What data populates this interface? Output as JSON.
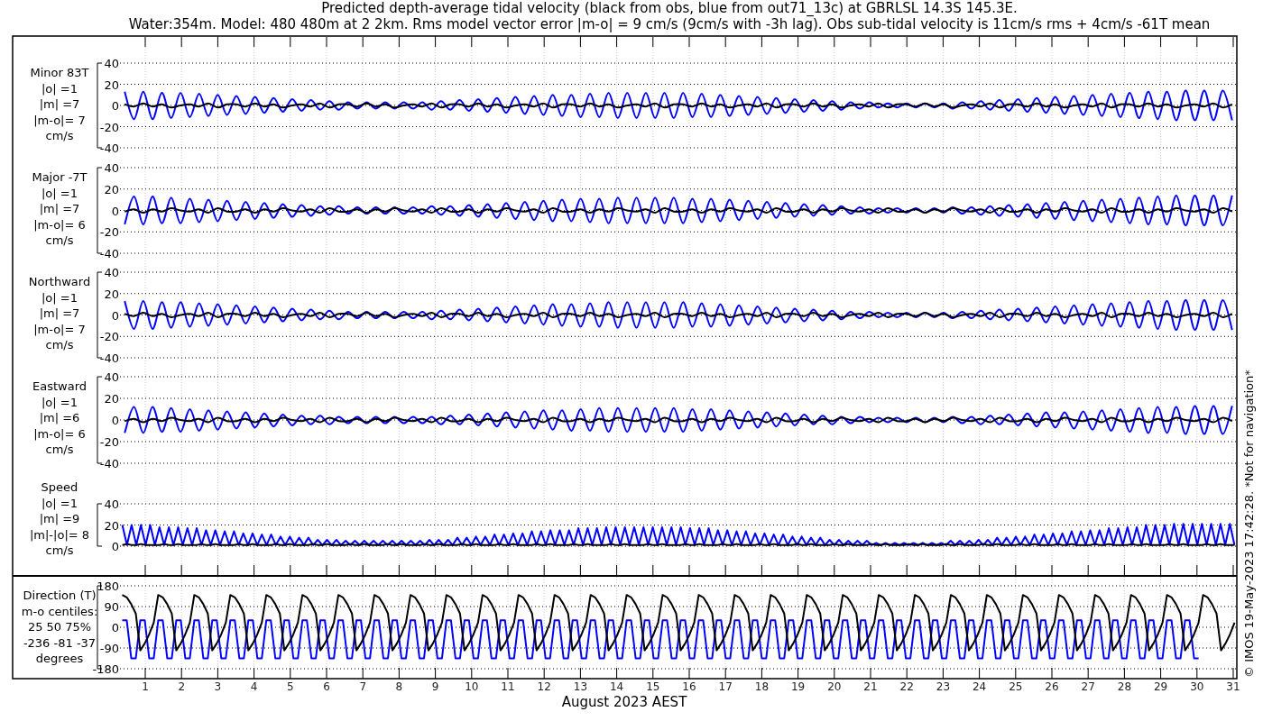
{
  "title": [
    "Predicted depth-average tidal velocity (black from obs, blue from out71_13c) at GBRLSL 14.3S 145.3E.",
    "Water:354m. Model: 480 480m at 2 2km. Rms model vector error |m-o| = 9 cm/s (9cm/s with -3h lag). Obs sub-tidal velocity is 11cm/s rms + 4cm/s -61T mean"
  ],
  "panels": [
    {
      "kind": "velocity",
      "label_lines": [
        "Minor 83T",
        "|o| =1",
        "|m| =7",
        "|m-o|= 7",
        "cm/s"
      ],
      "chart_data": {
        "type": "line",
        "grid": true,
        "ylim": [
          -40,
          40
        ],
        "yticks": [
          40,
          20,
          0,
          -20,
          -40
        ],
        "series": [
          {
            "color": "#000000",
            "values": [
              1,
              -1,
              2,
              -1,
              1,
              -2,
              0,
              1,
              -1,
              2,
              -2,
              1,
              1,
              -1,
              2,
              -1,
              1,
              -2,
              0,
              1,
              -1,
              2,
              -2,
              1,
              1,
              -1,
              2,
              -1,
              1,
              -2,
              0,
              1,
              -1,
              2,
              -2,
              1,
              1,
              -1,
              2,
              -1,
              1,
              -2,
              0,
              1,
              -1,
              2,
              -2,
              1,
              1,
              -1,
              2,
              -1,
              1,
              -2,
              0,
              1,
              -1,
              2,
              -2,
              1,
              1,
              -1,
              2,
              -1,
              1,
              -2,
              0,
              1,
              -1,
              2,
              -2,
              1,
              1,
              -1,
              2,
              -1,
              1,
              -2,
              0,
              1,
              -1,
              2,
              -2,
              1,
              1,
              -1,
              2,
              -1,
              1,
              -2,
              0,
              1,
              -1,
              2,
              -2,
              1,
              1,
              -1,
              2,
              -1,
              1,
              -2,
              0,
              1,
              -1,
              2,
              -2,
              1,
              1,
              -1,
              2,
              -1,
              1,
              -2,
              0,
              1,
              -1,
              2,
              -2,
              1
            ]
          },
          {
            "color": "#0000ff",
            "values": [
              13,
              -13,
              13,
              -13,
              12,
              -12,
              12,
              -11,
              11,
              -10,
              10,
              -9,
              9,
              -8,
              8,
              -7,
              7,
              -6,
              6,
              -5,
              5,
              -4,
              4,
              -4,
              3,
              -3,
              3,
              -3,
              3,
              -3,
              3,
              -3,
              3,
              -4,
              4,
              -4,
              5,
              -5,
              6,
              -6,
              7,
              -7,
              8,
              -8,
              9,
              -9,
              10,
              -10,
              10,
              -11,
              11,
              -11,
              12,
              -12,
              12,
              -12,
              12,
              -12,
              12,
              -12,
              12,
              -11,
              11,
              -11,
              10,
              -10,
              9,
              -9,
              8,
              -8,
              7,
              -7,
              6,
              -6,
              5,
              -5,
              4,
              -4,
              3,
              -3,
              3,
              -2,
              2,
              -2,
              2,
              -2,
              2,
              -2,
              2,
              -3,
              3,
              -3,
              4,
              -4,
              5,
              -5,
              6,
              -6,
              7,
              -7,
              8,
              -8,
              9,
              -9,
              10,
              -10,
              11,
              -11,
              12,
              -12,
              13,
              -13,
              13,
              -14,
              14,
              -14,
              14,
              -14,
              14,
              -14
            ]
          }
        ]
      }
    },
    {
      "kind": "velocity",
      "label_lines": [
        "Major -7T",
        "|o| =1",
        "|m| =7",
        "|m-o|= 6",
        "cm/s"
      ],
      "chart_data": {
        "type": "line",
        "grid": true,
        "ylim": [
          -40,
          40
        ],
        "yticks": [
          40,
          20,
          0,
          -20,
          -40
        ],
        "series": [
          {
            "color": "#000000",
            "values": [
              -1,
              1,
              -2,
              1,
              -1,
              2,
              0,
              -1,
              1,
              -2,
              2,
              -1,
              -1,
              1,
              -2,
              1,
              -1,
              2,
              0,
              -1,
              1,
              -2,
              2,
              -1,
              -1,
              1,
              -2,
              1,
              -1,
              2,
              0,
              -1,
              1,
              -2,
              2,
              -1,
              -1,
              1,
              -2,
              1,
              -1,
              2,
              0,
              -1,
              1,
              -2,
              2,
              -1,
              -1,
              1,
              -2,
              1,
              -1,
              2,
              0,
              -1,
              1,
              -2,
              2,
              -1,
              -1,
              1,
              -2,
              1,
              -1,
              2,
              0,
              -1,
              1,
              -2,
              2,
              -1,
              -1,
              1,
              -2,
              1,
              -1,
              2,
              0,
              -1,
              1,
              -2,
              2,
              -1,
              -1,
              1,
              -2,
              1,
              -1,
              2,
              0,
              -1,
              1,
              -2,
              2,
              -1,
              -1,
              1,
              -2,
              1,
              -1,
              2,
              0,
              -1,
              1,
              -2,
              2,
              -1,
              -1,
              1,
              -2,
              1,
              -1,
              2,
              0,
              -1,
              1,
              -2,
              2,
              -1
            ]
          },
          {
            "color": "#0000ff",
            "values": [
              -13,
              13,
              -13,
              13,
              -12,
              12,
              -12,
              11,
              -11,
              10,
              -10,
              9,
              -9,
              8,
              -8,
              7,
              -7,
              6,
              -6,
              5,
              -5,
              4,
              -4,
              4,
              -3,
              3,
              -3,
              3,
              -3,
              3,
              -3,
              3,
              -3,
              4,
              -4,
              4,
              -5,
              5,
              -6,
              6,
              -7,
              7,
              -8,
              8,
              -9,
              9,
              -10,
              10,
              -10,
              11,
              -11,
              11,
              -12,
              12,
              -12,
              12,
              -12,
              12,
              -12,
              12,
              -12,
              11,
              -11,
              11,
              -10,
              10,
              -9,
              9,
              -8,
              8,
              -7,
              7,
              -6,
              6,
              -5,
              5,
              -4,
              4,
              -3,
              3,
              -3,
              2,
              -2,
              2,
              -2,
              2,
              -2,
              2,
              -2,
              3,
              -3,
              3,
              -4,
              4,
              -5,
              5,
              -6,
              6,
              -7,
              7,
              -8,
              8,
              -9,
              9,
              -10,
              10,
              -11,
              11,
              -12,
              12,
              -13,
              13,
              -13,
              14,
              -14,
              14,
              -14,
              14,
              -14,
              14
            ]
          }
        ]
      }
    },
    {
      "kind": "velocity",
      "label_lines": [
        "Northward",
        "|o| =1",
        "|m| =7",
        "|m-o|= 7",
        "cm/s"
      ],
      "chart_data": {
        "type": "line",
        "grid": true,
        "ylim": [
          -40,
          40
        ],
        "yticks": [
          40,
          20,
          0,
          -20,
          -40
        ],
        "series": [
          {
            "color": "#000000",
            "values": [
              1,
              -1,
              2,
              -1,
              1,
              -2,
              0,
              1,
              -1,
              2,
              -2,
              1,
              1,
              -1,
              2,
              -1,
              1,
              -2,
              0,
              1,
              -1,
              2,
              -2,
              1,
              1,
              -1,
              2,
              -1,
              1,
              -2,
              0,
              1,
              -1,
              2,
              -2,
              1,
              1,
              -1,
              2,
              -1,
              1,
              -2,
              0,
              1,
              -1,
              2,
              -2,
              1,
              1,
              -1,
              2,
              -1,
              1,
              -2,
              0,
              1,
              -1,
              2,
              -2,
              1,
              1,
              -1,
              2,
              -1,
              1,
              -2,
              0,
              1,
              -1,
              2,
              -2,
              1,
              1,
              -1,
              2,
              -1,
              1,
              -2,
              0,
              1,
              -1,
              2,
              -2,
              1,
              1,
              -1,
              2,
              -1,
              1,
              -2,
              0,
              1,
              -1,
              2,
              -2,
              1,
              1,
              -1,
              2,
              -1,
              1,
              -2,
              0,
              1,
              -1,
              2,
              -2,
              1,
              1,
              -1,
              2,
              -1,
              1,
              -2,
              0,
              1,
              -1,
              2,
              -2,
              1
            ]
          },
          {
            "color": "#0000ff",
            "values": [
              13,
              -13,
              13,
              -13,
              12,
              -12,
              12,
              -11,
              11,
              -10,
              10,
              -9,
              9,
              -8,
              8,
              -7,
              7,
              -6,
              6,
              -5,
              5,
              -4,
              4,
              -4,
              3,
              -3,
              3,
              -3,
              3,
              -3,
              3,
              -3,
              3,
              -4,
              4,
              -4,
              5,
              -5,
              6,
              -6,
              7,
              -7,
              8,
              -8,
              9,
              -9,
              10,
              -10,
              10,
              -11,
              11,
              -11,
              12,
              -12,
              12,
              -12,
              12,
              -12,
              12,
              -12,
              12,
              -11,
              11,
              -11,
              10,
              -10,
              9,
              -9,
              8,
              -8,
              7,
              -7,
              6,
              -6,
              5,
              -5,
              4,
              -4,
              3,
              -3,
              3,
              -2,
              2,
              -2,
              2,
              -2,
              2,
              -2,
              2,
              -3,
              3,
              -3,
              4,
              -4,
              5,
              -5,
              6,
              -6,
              7,
              -7,
              8,
              -8,
              9,
              -9,
              10,
              -10,
              11,
              -11,
              12,
              -12,
              13,
              -13,
              13,
              -14,
              14,
              -14,
              14,
              -14,
              14,
              -14
            ]
          }
        ]
      }
    },
    {
      "kind": "velocity",
      "label_lines": [
        "Eastward",
        "|o| =1",
        "|m| =6",
        "|m-o|= 6",
        "cm/s"
      ],
      "chart_data": {
        "type": "line",
        "grid": true,
        "ylim": [
          -40,
          40
        ],
        "yticks": [
          40,
          20,
          0,
          -20,
          -40
        ],
        "series": [
          {
            "color": "#000000",
            "values": [
              -1,
              1,
              -2,
              1,
              -1,
              2,
              0,
              -1,
              1,
              -2,
              2,
              -1,
              -1,
              1,
              -2,
              1,
              -1,
              2,
              0,
              -1,
              1,
              -2,
              2,
              -1,
              -1,
              1,
              -2,
              1,
              -1,
              2,
              0,
              -1,
              1,
              -2,
              2,
              -1,
              -1,
              1,
              -2,
              1,
              -1,
              2,
              0,
              -1,
              1,
              -2,
              2,
              -1,
              -1,
              1,
              -2,
              1,
              -1,
              2,
              0,
              -1,
              1,
              -2,
              2,
              -1,
              -1,
              1,
              -2,
              1,
              -1,
              2,
              0,
              -1,
              1,
              -2,
              2,
              -1,
              -1,
              1,
              -2,
              1,
              -1,
              2,
              0,
              -1,
              1,
              -2,
              2,
              -1,
              -1,
              1,
              -2,
              1,
              -1,
              2,
              0,
              -1,
              1,
              -2,
              2,
              -1,
              -1,
              1,
              -2,
              1,
              -1,
              2,
              0,
              -1,
              1,
              -2,
              2,
              -1,
              -1,
              1,
              -2,
              1,
              -1,
              2,
              0,
              -1,
              1,
              -2,
              2,
              -1
            ]
          },
          {
            "color": "#0000ff",
            "values": [
              -12,
              12,
              -12,
              12,
              -11,
              11,
              -11,
              10,
              -10,
              9,
              -9,
              8,
              -8,
              7,
              -7,
              6,
              -6,
              5,
              -5,
              4,
              -4,
              4,
              -4,
              3,
              -3,
              3,
              -3,
              3,
              -3,
              3,
              -3,
              3,
              -3,
              3,
              -4,
              4,
              -4,
              5,
              -5,
              6,
              -6,
              7,
              -7,
              8,
              -8,
              9,
              -9,
              9,
              -10,
              10,
              -10,
              11,
              -11,
              11,
              -11,
              11,
              -11,
              11,
              -11,
              11,
              -11,
              10,
              -10,
              10,
              -9,
              9,
              -8,
              8,
              -7,
              7,
              -6,
              6,
              -5,
              5,
              -4,
              4,
              -4,
              3,
              -3,
              3,
              -2,
              2,
              -2,
              2,
              -2,
              2,
              -2,
              2,
              -2,
              3,
              -3,
              3,
              -4,
              4,
              -4,
              5,
              -5,
              6,
              -6,
              7,
              -7,
              7,
              -8,
              8,
              -9,
              9,
              -10,
              10,
              -11,
              11,
              -12,
              12,
              -12,
              12,
              -13,
              13,
              -13,
              13,
              -13,
              13
            ]
          }
        ]
      }
    },
    {
      "kind": "speed",
      "label_lines": [
        "Speed",
        "|o| =1",
        "|m| =9",
        "|m|-|o|= 8",
        "cm/s"
      ],
      "chart_data": {
        "type": "line",
        "grid": true,
        "ylim": [
          0,
          40
        ],
        "yticks": [
          40,
          20,
          0
        ],
        "series": [
          {
            "color": "#000000",
            "values": [
              1,
              2,
              1,
              1,
              2,
              1,
              1,
              1,
              1,
              2,
              1,
              1,
              2,
              1,
              1,
              1,
              1,
              2,
              1,
              1,
              2,
              1,
              1,
              1,
              1,
              2,
              1,
              1,
              2,
              1,
              1,
              1,
              1,
              2,
              1,
              1,
              2,
              1,
              1,
              1,
              1,
              2,
              1,
              1,
              2,
              1,
              1,
              1,
              1,
              2,
              1,
              1,
              2,
              1,
              1,
              1,
              1,
              2,
              1,
              1,
              2,
              1,
              1,
              1,
              1,
              2,
              1,
              1,
              2,
              1,
              1,
              1,
              1,
              2,
              1,
              1,
              2,
              1,
              1,
              1,
              1,
              2,
              1,
              1,
              2,
              1,
              1,
              1,
              1,
              2,
              1,
              1,
              2,
              1,
              1,
              1,
              1,
              2,
              1,
              1,
              2,
              1,
              1,
              1,
              1,
              2,
              1,
              1,
              2,
              1,
              1,
              1,
              1,
              2,
              1,
              1,
              2,
              1,
              1,
              1,
              1,
              2,
              1,
              1,
              2,
              1,
              1,
              1,
              1,
              2,
              1,
              1,
              2,
              1,
              1,
              1,
              1,
              2,
              1,
              1,
              2,
              1,
              1,
              1,
              1,
              2,
              1,
              1,
              2,
              1,
              1,
              1,
              1,
              2,
              1,
              1,
              2,
              1,
              1,
              1,
              1,
              2,
              1,
              1,
              2,
              1,
              1,
              1,
              1,
              2,
              1,
              1,
              2,
              1,
              1,
              1,
              1,
              2,
              1,
              1,
              2,
              1,
              1,
              1,
              1,
              2,
              1,
              1,
              2,
              1,
              1,
              1,
              1,
              2,
              1,
              1,
              2,
              1,
              1,
              1,
              1,
              2,
              1,
              1,
              2,
              1,
              1,
              1,
              1,
              2,
              1,
              1,
              2,
              1,
              1,
              1,
              1,
              2,
              1,
              1,
              2,
              1,
              1,
              1,
              1,
              2,
              1,
              1,
              2,
              1,
              1,
              1,
              1,
              2,
              1,
              1,
              2,
              1,
              1,
              1
            ]
          },
          {
            "color": "#0000ff",
            "values": [
              20,
              1,
              20,
              1,
              20,
              1,
              20,
              1,
              18,
              1,
              18,
              1,
              18,
              1,
              17,
              1,
              17,
              1,
              15,
              1,
              15,
              1,
              14,
              1,
              14,
              1,
              12,
              1,
              12,
              1,
              11,
              1,
              11,
              1,
              9,
              1,
              9,
              1,
              8,
              1,
              8,
              1,
              6,
              1,
              6,
              1,
              6,
              1,
              5,
              1,
              5,
              1,
              5,
              1,
              5,
              1,
              5,
              1,
              5,
              1,
              5,
              1,
              5,
              1,
              5,
              1,
              6,
              1,
              6,
              1,
              6,
              1,
              8,
              1,
              8,
              1,
              9,
              1,
              9,
              1,
              11,
              1,
              11,
              1,
              12,
              1,
              12,
              1,
              14,
              1,
              14,
              1,
              15,
              1,
              15,
              1,
              15,
              1,
              17,
              1,
              17,
              1,
              17,
              1,
              18,
              1,
              18,
              1,
              18,
              1,
              18,
              1,
              18,
              1,
              18,
              1,
              18,
              1,
              18,
              1,
              18,
              1,
              17,
              1,
              17,
              1,
              17,
              1,
              15,
              1,
              15,
              1,
              14,
              1,
              14,
              1,
              12,
              1,
              12,
              1,
              11,
              1,
              11,
              1,
              9,
              1,
              9,
              1,
              8,
              1,
              8,
              1,
              6,
              1,
              6,
              1,
              5,
              1,
              5,
              1,
              5,
              1,
              3,
              1,
              3,
              1,
              3,
              1,
              3,
              1,
              3,
              1,
              3,
              1,
              3,
              1,
              3,
              1,
              5,
              1,
              5,
              1,
              5,
              1,
              6,
              1,
              6,
              1,
              8,
              1,
              8,
              1,
              9,
              1,
              9,
              1,
              11,
              1,
              11,
              1,
              12,
              1,
              12,
              1,
              14,
              1,
              14,
              1,
              15,
              1,
              15,
              1,
              17,
              1,
              17,
              1,
              18,
              1,
              18,
              1,
              20,
              1,
              20,
              1,
              20,
              1,
              21,
              1,
              21,
              1,
              21,
              1,
              21,
              1,
              21,
              1,
              21,
              1,
              21,
              1
            ]
          }
        ]
      }
    },
    {
      "kind": "direction",
      "label_lines": [
        "Direction (T)",
        "m-o centiles:",
        "25  50  75%",
        "-236  -81  -37",
        "degrees"
      ],
      "chart_data": {
        "type": "line",
        "grid": true,
        "ylim": [
          -180,
          180
        ],
        "yticks": [
          180,
          90,
          0,
          -90,
          -180
        ],
        "series": [
          {
            "color": "#000000",
            "values": [
              140,
              130,
              100,
              60,
              -100,
              -70,
              -30,
              20,
              140,
              130,
              100,
              60,
              -100,
              -70,
              -30,
              20,
              140,
              130,
              100,
              60,
              -100,
              -70,
              -30,
              20,
              140,
              130,
              100,
              60,
              -100,
              -70,
              -30,
              20,
              140,
              130,
              100,
              60,
              -100,
              -70,
              -30,
              20,
              140,
              130,
              100,
              60,
              -100,
              -70,
              -30,
              20,
              140,
              130,
              100,
              60,
              -100,
              -70,
              -30,
              20,
              140,
              130,
              100,
              60,
              -100,
              -70,
              -30,
              20,
              140,
              130,
              100,
              60,
              -100,
              -70,
              -30,
              20,
              140,
              130,
              100,
              60,
              -100,
              -70,
              -30,
              20,
              140,
              130,
              100,
              60,
              -100,
              -70,
              -30,
              20,
              140,
              130,
              100,
              60,
              -100,
              -70,
              -30,
              20,
              140,
              130,
              100,
              60,
              -100,
              -70,
              -30,
              20,
              140,
              130,
              100,
              60,
              -100,
              -70,
              -30,
              20,
              140,
              130,
              100,
              60,
              -100,
              -70,
              -30,
              20,
              140,
              130,
              100,
              60,
              -100,
              -70,
              -30,
              20,
              140,
              130,
              100,
              60,
              -100,
              -70,
              -30,
              20,
              140,
              130,
              100,
              60,
              -100,
              -70,
              -30,
              20,
              140,
              130,
              100,
              60,
              -100,
              -70,
              -30,
              20,
              140,
              130,
              100,
              60,
              -100,
              -70,
              -30,
              20,
              140,
              130,
              100,
              60,
              -100,
              -70,
              -30,
              20,
              140,
              130,
              100,
              60,
              -100,
              -70,
              -30,
              20,
              140,
              130,
              100,
              60,
              -100,
              -70,
              -30,
              20,
              140,
              130,
              100,
              60,
              -100,
              -70,
              -30,
              20,
              140,
              130,
              100,
              60,
              -100,
              -70,
              -30,
              20,
              140,
              130,
              100,
              60,
              -100,
              -70,
              -30,
              20,
              140,
              130,
              100,
              60,
              -100,
              -70,
              -30,
              20,
              140,
              130,
              100,
              60,
              -100,
              -70,
              -30,
              20,
              140,
              130,
              100,
              60,
              -100,
              -70,
              -30,
              20,
              140,
              130,
              100,
              60,
              -100,
              -70,
              -30,
              20,
              140,
              130,
              100,
              60,
              -100,
              -70,
              -30,
              20
            ]
          },
          {
            "color": "#0000ff",
            "values": [
              30,
              30,
              -135,
              -135,
              30,
              30,
              -135,
              -135,
              30,
              30,
              -135,
              -135,
              30,
              30,
              -135,
              -135,
              30,
              30,
              -135,
              -135,
              30,
              30,
              -135,
              -135,
              30,
              30,
              -135,
              -135,
              30,
              30,
              -135,
              -135,
              30,
              30,
              -135,
              -135,
              30,
              30,
              -135,
              -135,
              30,
              30,
              -135,
              -135,
              30,
              30,
              -135,
              -135,
              30,
              30,
              -135,
              -135,
              30,
              30,
              -135,
              -135,
              30,
              30,
              -135,
              -135,
              30,
              30,
              -135,
              -135,
              30,
              30,
              -135,
              -135,
              30,
              30,
              -135,
              -135,
              30,
              30,
              -135,
              -135,
              30,
              30,
              -135,
              -135,
              30,
              30,
              -135,
              -135,
              30,
              30,
              -135,
              -135,
              30,
              30,
              -135,
              -135,
              30,
              30,
              -135,
              -135,
              30,
              30,
              -135,
              -135,
              30,
              30,
              -135,
              -135,
              30,
              30,
              -135,
              -135,
              30,
              30,
              -135,
              -135,
              30,
              30,
              -135,
              -135,
              30,
              30,
              -135,
              -135,
              30,
              30,
              -135,
              -135,
              30,
              30,
              -135,
              -135,
              30,
              30,
              -135,
              -135,
              30,
              30,
              -135,
              -135,
              30,
              30,
              -135,
              -135,
              30,
              30,
              -135,
              -135,
              30,
              30,
              -135,
              -135,
              30,
              30,
              -135,
              -135,
              30,
              30,
              -135,
              -135,
              30,
              30,
              -135,
              -135,
              30,
              30,
              -135,
              -135,
              30,
              30,
              -135,
              -135,
              30,
              30,
              -135,
              -135,
              30,
              30,
              -135,
              -135,
              30,
              30,
              -135,
              -135,
              30,
              30,
              -135,
              -135,
              30,
              30,
              -135,
              -135,
              30,
              30,
              -135,
              -135,
              30,
              30,
              -135,
              -135,
              30,
              30,
              -135,
              -135,
              30,
              30,
              -135,
              -135,
              30,
              30,
              -135,
              -135,
              30,
              30,
              -135,
              -135,
              30,
              30,
              -135,
              -135,
              30,
              30,
              -135,
              -135,
              30,
              30,
              -135,
              -135,
              30,
              30,
              -135,
              -135,
              30,
              30,
              -135,
              -135,
              30,
              30,
              -135,
              -135,
              30,
              30,
              -135,
              -135
            ]
          }
        ]
      }
    }
  ],
  "days": [
    "1",
    "2",
    "3",
    "4",
    "5",
    "6",
    "7",
    "8",
    "9",
    "10",
    "11",
    "12",
    "13",
    "14",
    "15",
    "16",
    "17",
    "18",
    "19",
    "20",
    "21",
    "22",
    "23",
    "24",
    "25",
    "26",
    "27",
    "28",
    "29",
    "30",
    "31"
  ],
  "xlabel": "August 2023 AEST",
  "side_note": "© IMOS 19-May-2023 17:42:28.  *Not for navigation*"
}
